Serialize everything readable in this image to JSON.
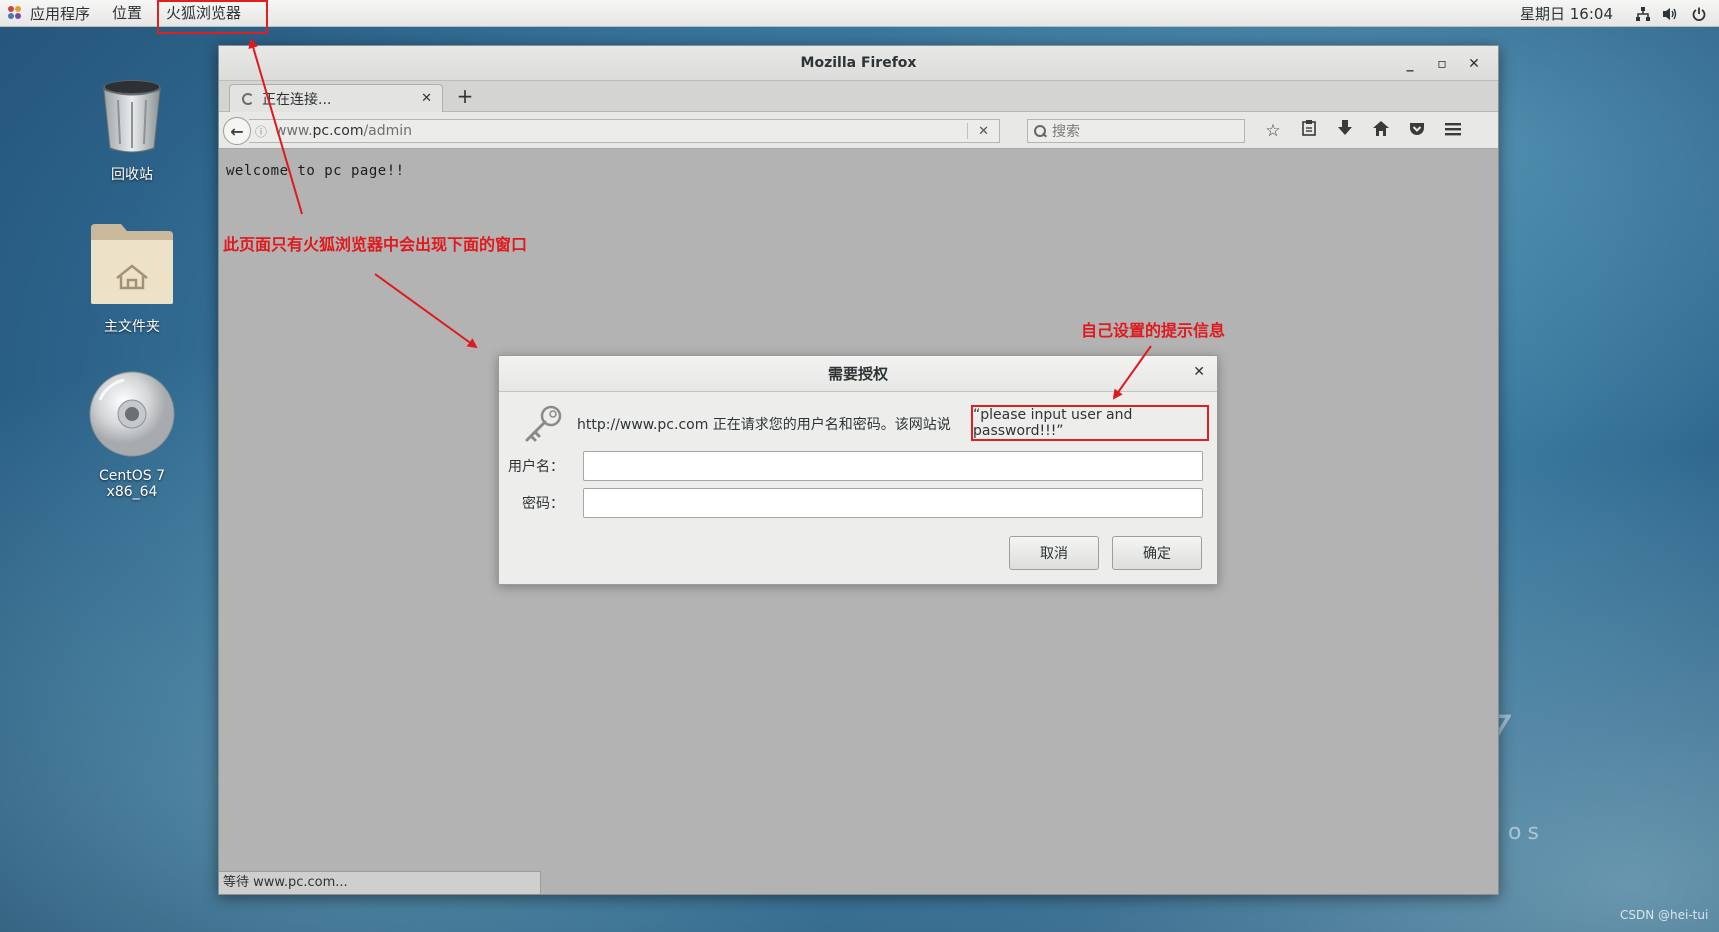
{
  "topbar": {
    "apps_label": "应用程序",
    "places_label": "位置",
    "active_app_label": "火狐浏览器",
    "clock": "星期日 16:04",
    "status_icons": [
      "network-icon",
      "volume-icon",
      "power-icon"
    ]
  },
  "desktop": {
    "icons": [
      {
        "label": "回收站",
        "icon": "trash-icon"
      },
      {
        "label": "主文件夹",
        "icon": "home-folder-icon"
      },
      {
        "label": "CentOS 7 x86_64",
        "icon": "disc-icon"
      }
    ],
    "wallpaper_glyph_7": "7",
    "wallpaper_glyph_os": "os"
  },
  "firefox": {
    "window_title": "Mozilla Firefox",
    "tab_label": "正在连接...",
    "url_prefix": "www.",
    "url_domain": "pc.com",
    "url_path": "/admin",
    "search_placeholder": "搜索",
    "page_text": "welcome to pc page!!",
    "status_text": "等待 www.pc.com..."
  },
  "auth_dialog": {
    "title": "需要授权",
    "message": "http://www.pc.com 正在请求您的用户名和密码。该网站说",
    "realm": "“please input user and password!!!”",
    "username_label": "用户名：",
    "password_label": "密码：",
    "username_value": "",
    "password_value": "",
    "cancel_label": "取消",
    "ok_label": "确定"
  },
  "annotations": {
    "note_firefox_only": "此页面只有火狐浏览器中会出现下面的窗口",
    "note_custom_prompt": "自己设置的提示信息",
    "color": "#e0191d"
  },
  "watermark": "CSDN @hei-tui"
}
